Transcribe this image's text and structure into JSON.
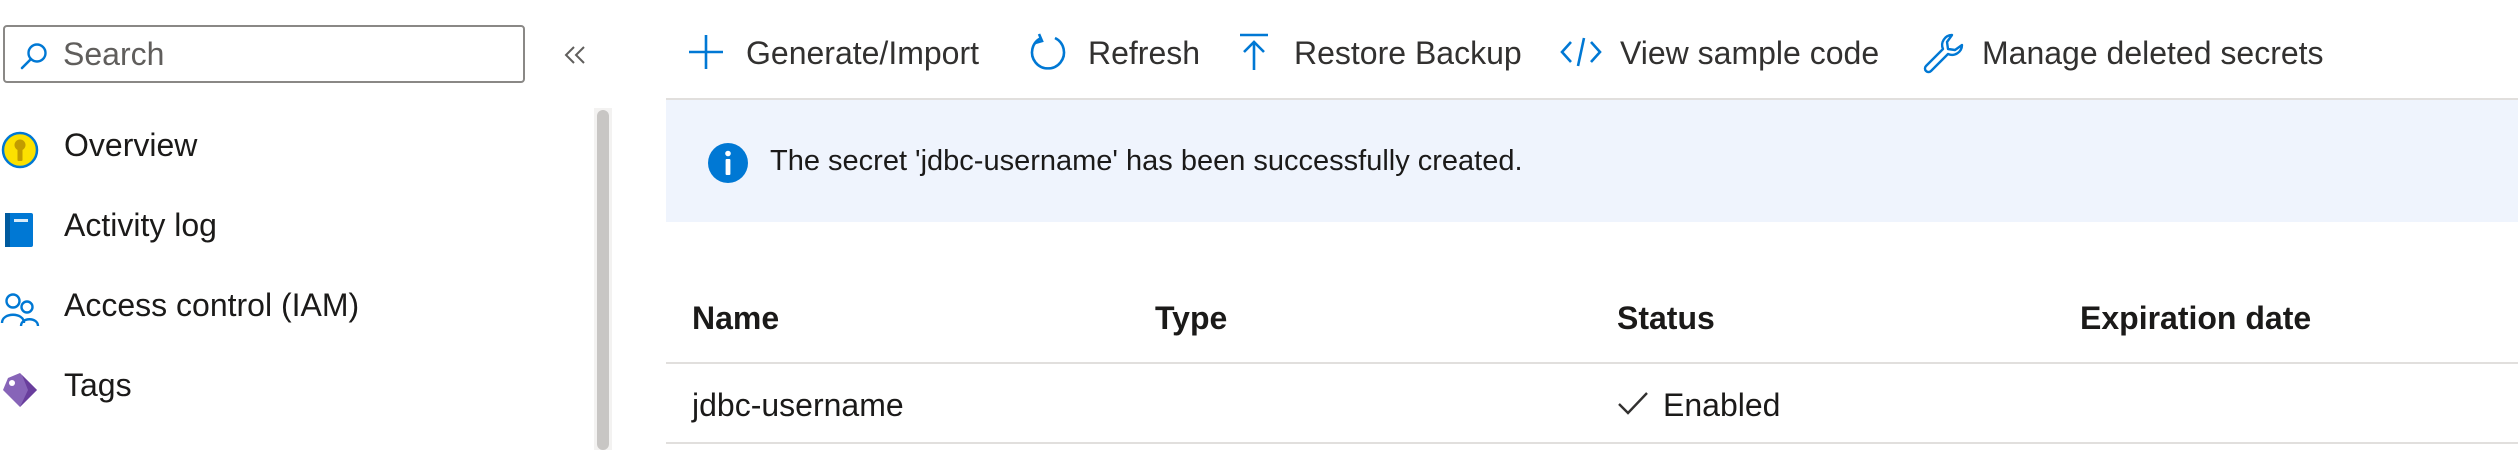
{
  "search": {
    "placeholder": "Search"
  },
  "sidebar": {
    "collapse_icon": "double-chevron-left-icon",
    "items": [
      {
        "label": "Overview",
        "icon": "key-vault-overview-icon"
      },
      {
        "label": "Activity log",
        "icon": "activity-log-icon"
      },
      {
        "label": "Access control (IAM)",
        "icon": "people-icon"
      },
      {
        "label": "Tags",
        "icon": "tag-icon"
      }
    ]
  },
  "toolbar": {
    "generate_label": "Generate/Import",
    "refresh_label": "Refresh",
    "restore_label": "Restore Backup",
    "sample_code_label": "View sample code",
    "manage_deleted_label": "Manage deleted secrets"
  },
  "banner": {
    "icon": "info-icon",
    "message": "The secret 'jdbc-username' has been successfully created."
  },
  "table": {
    "columns": [
      "Name",
      "Type",
      "Status",
      "Expiration date"
    ],
    "rows": [
      {
        "name": "jdbc-username",
        "type": "",
        "status": "Enabled",
        "expiration": ""
      }
    ]
  },
  "colors": {
    "accent": "#0078d4",
    "banner_background": "#eff4fd",
    "divider": "#e1dfdd"
  }
}
